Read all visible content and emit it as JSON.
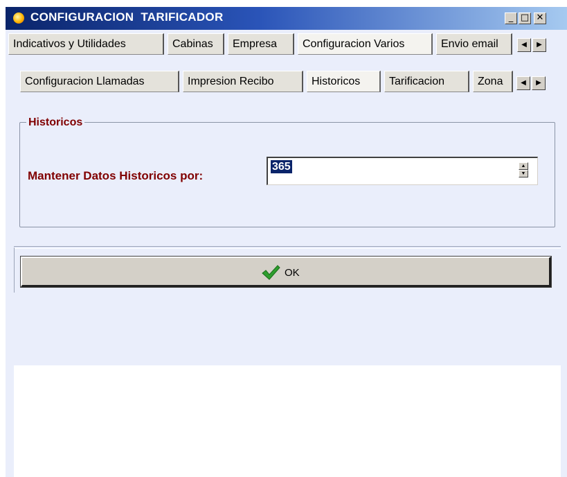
{
  "window": {
    "title": "CONFIGURACION  TARIFICADOR",
    "controls": {
      "minimize": "_",
      "maximize": "□",
      "close": "✕"
    }
  },
  "main_tabs": [
    {
      "label": "Indicativos y Utilidades"
    },
    {
      "label": "Cabinas"
    },
    {
      "label": "Empresa"
    },
    {
      "label": "Configuracion Varios",
      "active": true
    },
    {
      "label": "Envio email"
    }
  ],
  "sub_tabs": [
    {
      "label": "Configuracion Llamadas"
    },
    {
      "label": "Impresion Recibo"
    },
    {
      "label": "Historicos",
      "active": true
    },
    {
      "label": "Tarificacion"
    },
    {
      "label": "Zona"
    }
  ],
  "tab_scroll": {
    "left": "◀",
    "right": "▶"
  },
  "historicos": {
    "group_title": "Historicos",
    "field_label": "Mantener Datos Historicos por:",
    "field_value": "365"
  },
  "ok_button": {
    "label": "OK"
  },
  "colors": {
    "accent_label": "#800000",
    "title_gradient_start": "#0a246a",
    "check": "#2e9e2e"
  },
  "icons": [
    "app-icon",
    "check-icon",
    "spin-up-icon",
    "spin-down-icon"
  ]
}
